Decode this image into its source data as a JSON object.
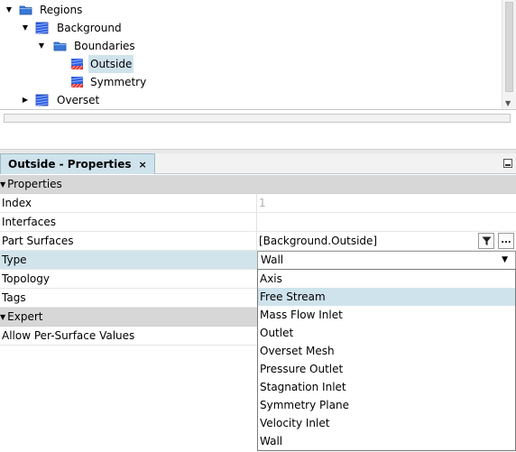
{
  "tree": {
    "items": [
      {
        "label": "Regions",
        "icon": "folder-icon",
        "toggle": "expanded"
      },
      {
        "label": "Background",
        "icon": "region-icon",
        "toggle": "expanded"
      },
      {
        "label": "Boundaries",
        "icon": "folder-icon",
        "toggle": "expanded"
      },
      {
        "label": "Outside",
        "icon": "boundary-icon",
        "toggle": "",
        "selected": true
      },
      {
        "label": "Symmetry",
        "icon": "boundary-icon",
        "toggle": ""
      },
      {
        "label": "Overset",
        "icon": "region-icon",
        "toggle": "collapsed"
      }
    ]
  },
  "properties": {
    "tab_title": "Outside - Properties",
    "tab_close": "×",
    "sections": {
      "properties_label": "Properties",
      "expert_label": "Expert"
    },
    "rows": {
      "index": {
        "name": "Index",
        "value": "1"
      },
      "interfaces": {
        "name": "Interfaces",
        "value": ""
      },
      "part_surfaces": {
        "name": "Part Surfaces",
        "value": "[Background.Outside]"
      },
      "type": {
        "name": "Type",
        "value": "Wall"
      },
      "topology": {
        "name": "Topology"
      },
      "tags": {
        "name": "Tags"
      },
      "allow_per_surface": {
        "name": "Allow Per-Surface Values"
      }
    },
    "more_button_label": "...",
    "type_options": [
      "Axis",
      "Free Stream",
      "Mass Flow Inlet",
      "Outlet",
      "Overset Mesh",
      "Pressure Outlet",
      "Stagnation Inlet",
      "Symmetry Plane",
      "Velocity Inlet",
      "Wall"
    ],
    "type_options_highlighted": "Free Stream"
  },
  "colors": {
    "selection": "#cfe3ed",
    "category_row": "#d7d7d7",
    "folder_blue": "#3a78d8",
    "region_blue": "#2f5fe0",
    "boundary_red": "#e03030"
  }
}
